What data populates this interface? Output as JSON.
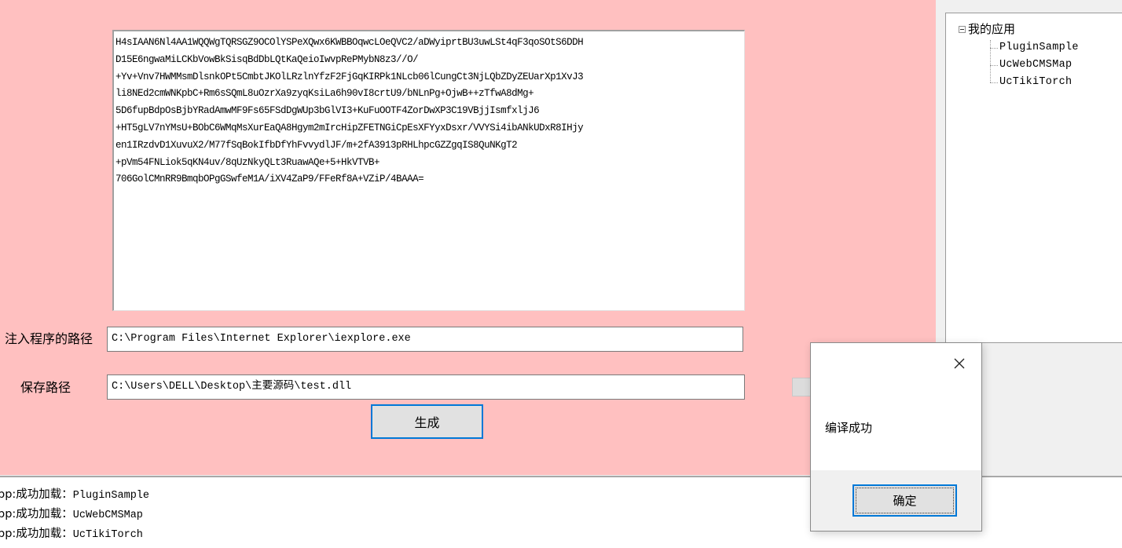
{
  "main": {
    "code_lines": [
      "H4sIAAN6Nl4AA1WQQWgTQRSGZ9OCOlYSPeXQwx6KWBBOqwcLOeQVC2/aDWyiprtBU3uwLSt4qF3qoSOtS6DDH",
      "D15E6ngwaMiLCKbVowBkSisqBdDbLQtKaQeioIwvpRePMybN8z3//O/",
      "+Yv+Vnv7HWMMsmDlsnkOPt5CmbtJKOlLRzlnYfzF2FjGqKIRPk1NLcb06lCungCt3NjLQbZDyZEUarXp1XvJ3",
      "li8NEd2cmWNKpbC+Rm6sSQmL8uOzrXa9zyqKsiLa6h90vI8crtU9/bNLnPg+OjwB++zTfwA8dMg+",
      "5D6fupBdpOsBjbYRadAmwMF9Fs65FSdDgWUp3bGlVI3+KuFuOOTF4ZorDwXP3C19VBjjIsmfxljJ6",
      "+HT5gLV7nYMsU+BObC6WMqMsXurEaQA8Hgym2mIrcHipZFETNGiCpEsXFYyxDsxr/VVYSi4ibANkUDxR8IHjy",
      "en1IRzdvD1XuvuX2/M77fSqBokIfbDfYhFvvydlJF/m+2fA3913pRHLhpcGZZgqIS8QuNKgT2",
      "+pVm54FNLiok5qKN4uv/8qUzNkyQLt3RuawAQe+5+HkVTVB+",
      "706GolCMnRR9BmqbOPgGSwfeM1A/iXV4ZaP9/FFeRf8A+VZiP/4BAAA="
    ],
    "inject_label": "注入程序的路径",
    "inject_value": "C:\\Program Files\\Internet Explorer\\iexplore.exe",
    "save_label": "保存路径",
    "save_value": "C:\\Users\\DELL\\Desktop\\主要源码\\test.dll",
    "generate_label": "生成"
  },
  "tree": {
    "root_label": "我的应用",
    "items": [
      "PluginSample",
      "UcWebCMSMap",
      "UcTikiTorch"
    ]
  },
  "log": {
    "lines": [
      {
        "prefix": "pp:成功加载：",
        "name": "PluginSample"
      },
      {
        "prefix": "pp:成功加载：",
        "name": "UcWebCMSMap"
      },
      {
        "prefix": "pp:成功加载：",
        "name": "UcTikiTorch"
      }
    ]
  },
  "dialog": {
    "message": "编译成功",
    "ok_label": "确定",
    "close_icon": "close-icon"
  },
  "colors": {
    "panel_bg": "#ffc0c0",
    "focus_border": "#0078d7",
    "window_bg": "#f0f0f0"
  }
}
